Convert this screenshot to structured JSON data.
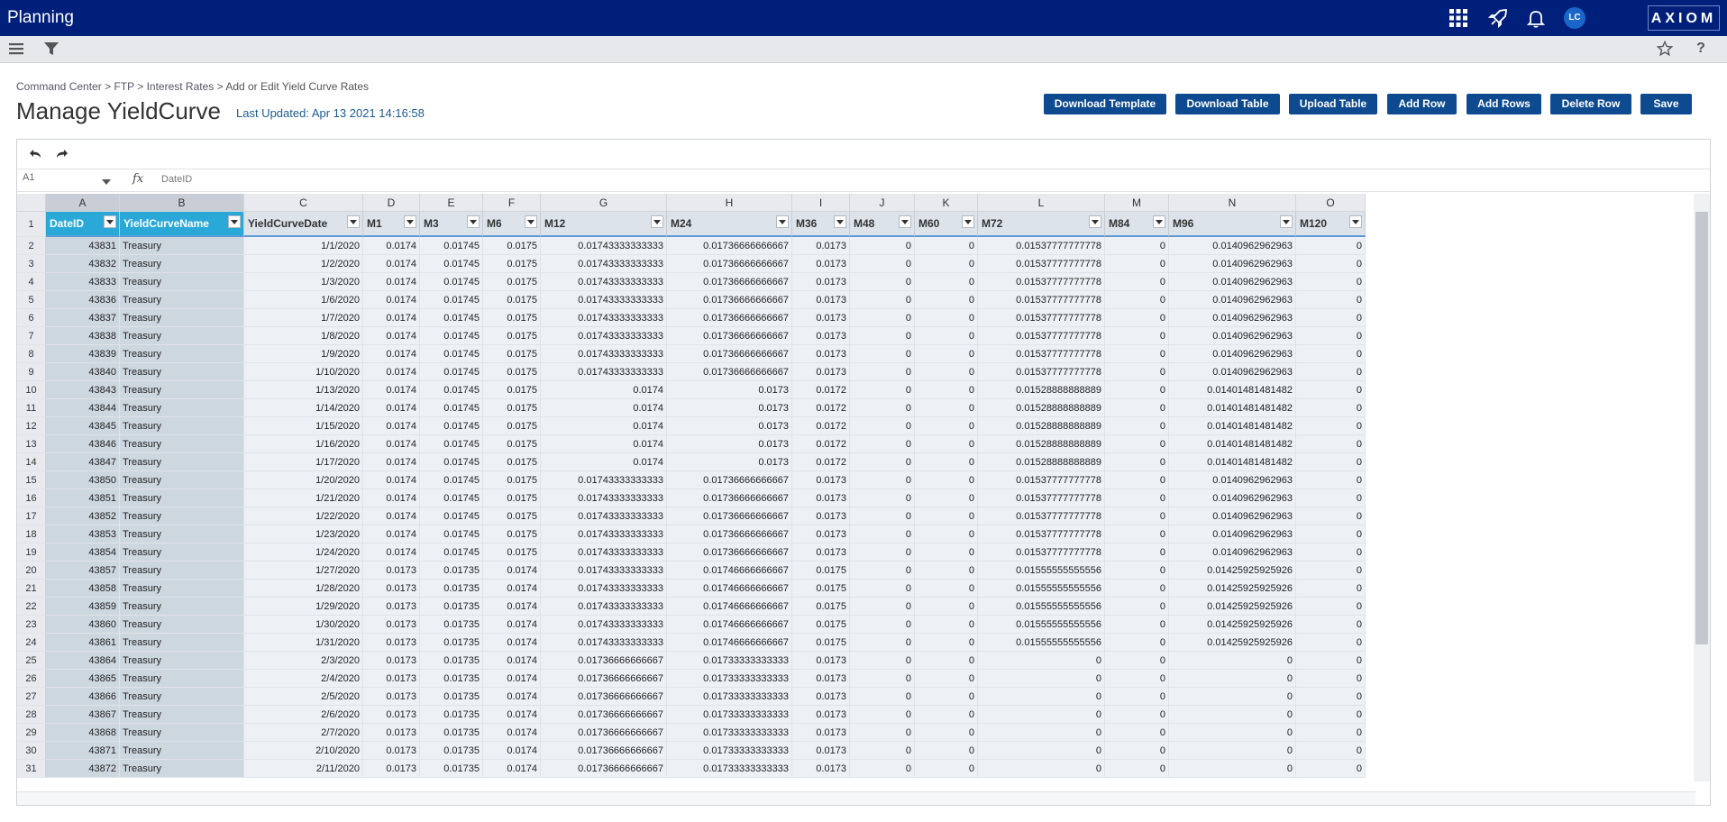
{
  "app": {
    "title": "Planning",
    "user_initials": "LC",
    "logo": "AXIOM"
  },
  "topbar_icons": [
    "apps-grid-icon",
    "rocket-icon",
    "bell-icon"
  ],
  "subbar_icons": [
    "menu-icon",
    "filter-icon",
    "star-icon",
    "help-icon"
  ],
  "breadcrumb": {
    "items": [
      "Command Center",
      "FTP",
      "Interest Rates"
    ],
    "separator": ">",
    "current": "Add or Edit Yield Curve Rates"
  },
  "page": {
    "title": "Manage YieldCurve",
    "last_updated": "Last Updated: Apr 13 2021 14:16:58"
  },
  "toolbar": {
    "buttons": [
      "Download Template",
      "Download Table",
      "Upload Table",
      "Add Row",
      "Add Rows",
      "Delete Row",
      "Save"
    ]
  },
  "sheet": {
    "name_box": "A1",
    "fx_label": "fx",
    "formula": "DateID",
    "column_letters": [
      "A",
      "B",
      "C",
      "D",
      "E",
      "F",
      "G",
      "H",
      "I",
      "J",
      "K",
      "L",
      "M",
      "N",
      "O"
    ],
    "header_row_number": "1",
    "headers": [
      "DateID",
      "YieldCurveName",
      "YieldCurveDate",
      "M1",
      "M3",
      "M6",
      "M12",
      "M24",
      "M36",
      "M48",
      "M60",
      "M72",
      "M84",
      "M96",
      "M120"
    ],
    "rows": [
      [
        "2",
        "43831",
        "Treasury",
        "1/1/2020",
        "0.0174",
        "0.01745",
        "0.0175",
        "0.01743333333333",
        "0.01736666666667",
        "0.0173",
        "0",
        "0",
        "0.01537777777778",
        "0",
        "0.0140962962963",
        "0"
      ],
      [
        "3",
        "43832",
        "Treasury",
        "1/2/2020",
        "0.0174",
        "0.01745",
        "0.0175",
        "0.01743333333333",
        "0.01736666666667",
        "0.0173",
        "0",
        "0",
        "0.01537777777778",
        "0",
        "0.0140962962963",
        "0"
      ],
      [
        "4",
        "43833",
        "Treasury",
        "1/3/2020",
        "0.0174",
        "0.01745",
        "0.0175",
        "0.01743333333333",
        "0.01736666666667",
        "0.0173",
        "0",
        "0",
        "0.01537777777778",
        "0",
        "0.0140962962963",
        "0"
      ],
      [
        "5",
        "43836",
        "Treasury",
        "1/6/2020",
        "0.0174",
        "0.01745",
        "0.0175",
        "0.01743333333333",
        "0.01736666666667",
        "0.0173",
        "0",
        "0",
        "0.01537777777778",
        "0",
        "0.0140962962963",
        "0"
      ],
      [
        "6",
        "43837",
        "Treasury",
        "1/7/2020",
        "0.0174",
        "0.01745",
        "0.0175",
        "0.01743333333333",
        "0.01736666666667",
        "0.0173",
        "0",
        "0",
        "0.01537777777778",
        "0",
        "0.0140962962963",
        "0"
      ],
      [
        "7",
        "43838",
        "Treasury",
        "1/8/2020",
        "0.0174",
        "0.01745",
        "0.0175",
        "0.01743333333333",
        "0.01736666666667",
        "0.0173",
        "0",
        "0",
        "0.01537777777778",
        "0",
        "0.0140962962963",
        "0"
      ],
      [
        "8",
        "43839",
        "Treasury",
        "1/9/2020",
        "0.0174",
        "0.01745",
        "0.0175",
        "0.01743333333333",
        "0.01736666666667",
        "0.0173",
        "0",
        "0",
        "0.01537777777778",
        "0",
        "0.0140962962963",
        "0"
      ],
      [
        "9",
        "43840",
        "Treasury",
        "1/10/2020",
        "0.0174",
        "0.01745",
        "0.0175",
        "0.01743333333333",
        "0.01736666666667",
        "0.0173",
        "0",
        "0",
        "0.01537777777778",
        "0",
        "0.0140962962963",
        "0"
      ],
      [
        "10",
        "43843",
        "Treasury",
        "1/13/2020",
        "0.0174",
        "0.01745",
        "0.0175",
        "0.0174",
        "0.0173",
        "0.0172",
        "0",
        "0",
        "0.01528888888889",
        "0",
        "0.01401481481482",
        "0"
      ],
      [
        "11",
        "43844",
        "Treasury",
        "1/14/2020",
        "0.0174",
        "0.01745",
        "0.0175",
        "0.0174",
        "0.0173",
        "0.0172",
        "0",
        "0",
        "0.01528888888889",
        "0",
        "0.01401481481482",
        "0"
      ],
      [
        "12",
        "43845",
        "Treasury",
        "1/15/2020",
        "0.0174",
        "0.01745",
        "0.0175",
        "0.0174",
        "0.0173",
        "0.0172",
        "0",
        "0",
        "0.01528888888889",
        "0",
        "0.01401481481482",
        "0"
      ],
      [
        "13",
        "43846",
        "Treasury",
        "1/16/2020",
        "0.0174",
        "0.01745",
        "0.0175",
        "0.0174",
        "0.0173",
        "0.0172",
        "0",
        "0",
        "0.01528888888889",
        "0",
        "0.01401481481482",
        "0"
      ],
      [
        "14",
        "43847",
        "Treasury",
        "1/17/2020",
        "0.0174",
        "0.01745",
        "0.0175",
        "0.0174",
        "0.0173",
        "0.0172",
        "0",
        "0",
        "0.01528888888889",
        "0",
        "0.01401481481482",
        "0"
      ],
      [
        "15",
        "43850",
        "Treasury",
        "1/20/2020",
        "0.0174",
        "0.01745",
        "0.0175",
        "0.01743333333333",
        "0.01736666666667",
        "0.0173",
        "0",
        "0",
        "0.01537777777778",
        "0",
        "0.0140962962963",
        "0"
      ],
      [
        "16",
        "43851",
        "Treasury",
        "1/21/2020",
        "0.0174",
        "0.01745",
        "0.0175",
        "0.01743333333333",
        "0.01736666666667",
        "0.0173",
        "0",
        "0",
        "0.01537777777778",
        "0",
        "0.0140962962963",
        "0"
      ],
      [
        "17",
        "43852",
        "Treasury",
        "1/22/2020",
        "0.0174",
        "0.01745",
        "0.0175",
        "0.01743333333333",
        "0.01736666666667",
        "0.0173",
        "0",
        "0",
        "0.01537777777778",
        "0",
        "0.0140962962963",
        "0"
      ],
      [
        "18",
        "43853",
        "Treasury",
        "1/23/2020",
        "0.0174",
        "0.01745",
        "0.0175",
        "0.01743333333333",
        "0.01736666666667",
        "0.0173",
        "0",
        "0",
        "0.01537777777778",
        "0",
        "0.0140962962963",
        "0"
      ],
      [
        "19",
        "43854",
        "Treasury",
        "1/24/2020",
        "0.0174",
        "0.01745",
        "0.0175",
        "0.01743333333333",
        "0.01736666666667",
        "0.0173",
        "0",
        "0",
        "0.01537777777778",
        "0",
        "0.0140962962963",
        "0"
      ],
      [
        "20",
        "43857",
        "Treasury",
        "1/27/2020",
        "0.0173",
        "0.01735",
        "0.0174",
        "0.01743333333333",
        "0.01746666666667",
        "0.0175",
        "0",
        "0",
        "0.01555555555556",
        "0",
        "0.01425925925926",
        "0"
      ],
      [
        "21",
        "43858",
        "Treasury",
        "1/28/2020",
        "0.0173",
        "0.01735",
        "0.0174",
        "0.01743333333333",
        "0.01746666666667",
        "0.0175",
        "0",
        "0",
        "0.01555555555556",
        "0",
        "0.01425925925926",
        "0"
      ],
      [
        "22",
        "43859",
        "Treasury",
        "1/29/2020",
        "0.0173",
        "0.01735",
        "0.0174",
        "0.01743333333333",
        "0.01746666666667",
        "0.0175",
        "0",
        "0",
        "0.01555555555556",
        "0",
        "0.01425925925926",
        "0"
      ],
      [
        "23",
        "43860",
        "Treasury",
        "1/30/2020",
        "0.0173",
        "0.01735",
        "0.0174",
        "0.01743333333333",
        "0.01746666666667",
        "0.0175",
        "0",
        "0",
        "0.01555555555556",
        "0",
        "0.01425925925926",
        "0"
      ],
      [
        "24",
        "43861",
        "Treasury",
        "1/31/2020",
        "0.0173",
        "0.01735",
        "0.0174",
        "0.01743333333333",
        "0.01746666666667",
        "0.0175",
        "0",
        "0",
        "0.01555555555556",
        "0",
        "0.01425925925926",
        "0"
      ],
      [
        "25",
        "43864",
        "Treasury",
        "2/3/2020",
        "0.0173",
        "0.01735",
        "0.0174",
        "0.01736666666667",
        "0.01733333333333",
        "0.0173",
        "0",
        "0",
        "0",
        "0",
        "0",
        "0"
      ],
      [
        "26",
        "43865",
        "Treasury",
        "2/4/2020",
        "0.0173",
        "0.01735",
        "0.0174",
        "0.01736666666667",
        "0.01733333333333",
        "0.0173",
        "0",
        "0",
        "0",
        "0",
        "0",
        "0"
      ],
      [
        "27",
        "43866",
        "Treasury",
        "2/5/2020",
        "0.0173",
        "0.01735",
        "0.0174",
        "0.01736666666667",
        "0.01733333333333",
        "0.0173",
        "0",
        "0",
        "0",
        "0",
        "0",
        "0"
      ],
      [
        "28",
        "43867",
        "Treasury",
        "2/6/2020",
        "0.0173",
        "0.01735",
        "0.0174",
        "0.01736666666667",
        "0.01733333333333",
        "0.0173",
        "0",
        "0",
        "0",
        "0",
        "0",
        "0"
      ],
      [
        "29",
        "43868",
        "Treasury",
        "2/7/2020",
        "0.0173",
        "0.01735",
        "0.0174",
        "0.01736666666667",
        "0.01733333333333",
        "0.0173",
        "0",
        "0",
        "0",
        "0",
        "0",
        "0"
      ],
      [
        "30",
        "43871",
        "Treasury",
        "2/10/2020",
        "0.0173",
        "0.01735",
        "0.0174",
        "0.01736666666667",
        "0.01733333333333",
        "0.0173",
        "0",
        "0",
        "0",
        "0",
        "0",
        "0"
      ],
      [
        "31",
        "43872",
        "Treasury",
        "2/11/2020",
        "0.0173",
        "0.01735",
        "0.0174",
        "0.01736666666667",
        "0.01733333333333",
        "0.0173",
        "0",
        "0",
        "0",
        "0",
        "0",
        "0"
      ]
    ]
  },
  "colors": {
    "topbar": "#001f7a",
    "button": "#0d4a8f",
    "key_header": "#2aa8d8",
    "link": "#1d5b93"
  }
}
